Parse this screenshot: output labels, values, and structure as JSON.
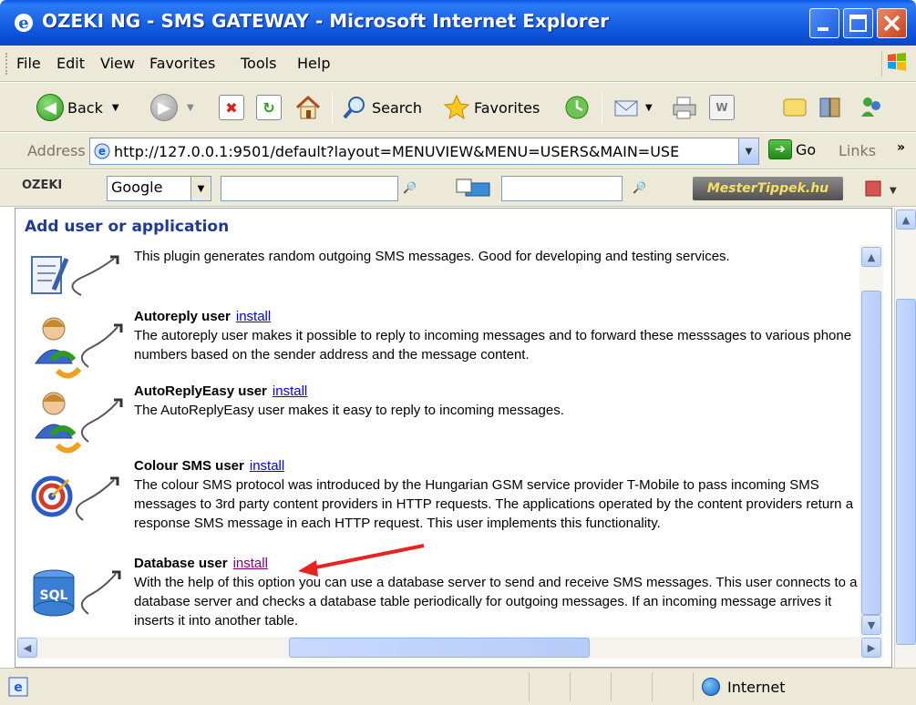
{
  "window": {
    "title": "OZEKI NG - SMS GATEWAY - Microsoft Internet Explorer"
  },
  "menu": [
    "File",
    "Edit",
    "View",
    "Favorites",
    "Tools",
    "Help"
  ],
  "toolbar": {
    "back_label": "Back",
    "search_label": "Search",
    "favorites_label": "Favorites"
  },
  "address": {
    "label": "Address",
    "url": "http://127.0.0.1:9501/default?layout=MENUVIEW&MENU=USERS&MAIN=USE",
    "go_label": "Go",
    "links_label": "Links"
  },
  "ozeki_toolbar": {
    "logo": "OZEKI",
    "search_engine": "Google",
    "mester_label": "MesterTippek.hu"
  },
  "page": {
    "section_title": "Add user or application",
    "items": [
      {
        "name": "",
        "link": "",
        "description": "This plugin generates random outgoing SMS messages. Good for developing and testing services."
      },
      {
        "name": "Autoreply user",
        "link": "install",
        "description": "The autoreply user makes it possible to reply to incoming messages and to forward these messsages to various phone numbers based on the sender address and the message content."
      },
      {
        "name": "AutoReplyEasy user",
        "link": "install",
        "description": "The AutoReplyEasy user makes it easy to reply to incoming messages."
      },
      {
        "name": "Colour SMS user",
        "link": "install",
        "description": "The colour SMS protocol was introduced by the Hungarian GSM service provider T-Mobile to pass incoming SMS messages to 3rd party content providers in HTTP requests. The applications operated by the content providers return a response SMS message in each HTTP request. This user implements this functionality."
      },
      {
        "name": "Database user",
        "link": "install",
        "description": "With the help of this option you can use a database server to send and receive SMS messages. This user connects to a database server and checks a database table periodically for outgoing messages. If an incoming message arrives it inserts it into another table."
      }
    ],
    "sql_icon_label": "SQL"
  },
  "status": {
    "zone": "Internet"
  },
  "colors": {
    "title_bar": "#0b4fd6",
    "chrome": "#ece9d8",
    "section_title": "#1f3a93",
    "link": "#0000ee",
    "visited_link": "#800080",
    "annotation_arrow": "#e8231f"
  }
}
